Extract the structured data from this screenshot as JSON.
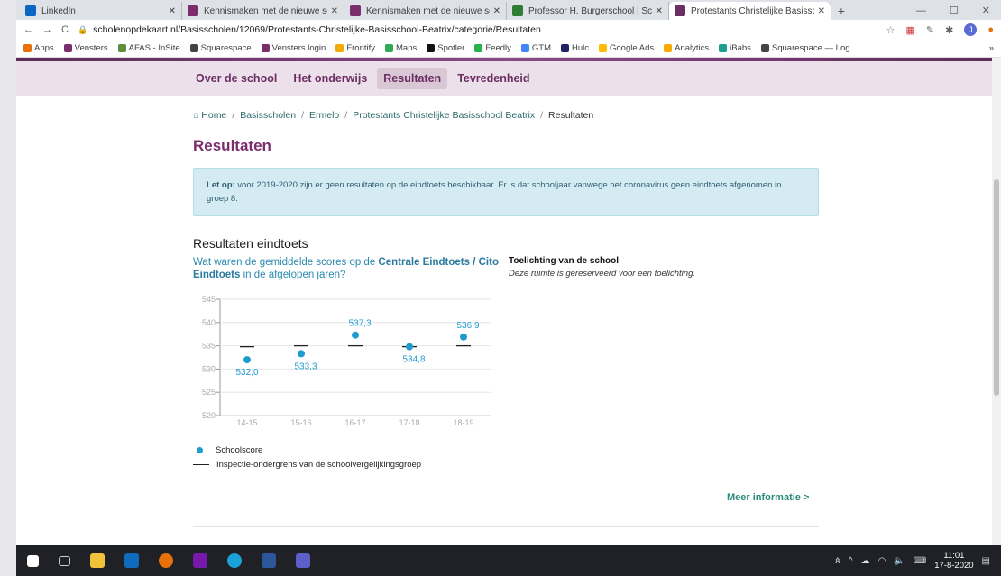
{
  "browser": {
    "tabs": [
      {
        "label": "LinkedIn",
        "color": "#0a66c2"
      },
      {
        "label": "Kennismaken met de nieuwe sch",
        "color": "#7b2d6e"
      },
      {
        "label": "Kennismaken met de nieuwe sch",
        "color": "#7b2d6e"
      },
      {
        "label": "Professor H. Burgerschool | Scho",
        "color": "#2e7d32"
      },
      {
        "label": "Protestants Christelijke Basissch",
        "color": "#6b2e63"
      }
    ],
    "new_tab": "+",
    "url": "scholenopdekaart.nl/Basisscholen/12069/Protestants-Christelijke-Basisschool-Beatrix/categorie/Resultaten",
    "profile_initial": "J",
    "bookmarks": [
      {
        "label": "Apps",
        "color": "#e8710a"
      },
      {
        "label": "Vensters",
        "color": "#7b2d6e"
      },
      {
        "label": "AFAS - InSite",
        "color": "#5f8f3a"
      },
      {
        "label": "Squarespace",
        "color": "#444444"
      },
      {
        "label": "Vensters login",
        "color": "#7b2d6e"
      },
      {
        "label": "Frontify",
        "color": "#f2a900"
      },
      {
        "label": "Maps",
        "color": "#34a853"
      },
      {
        "label": "Spotler",
        "color": "#111111"
      },
      {
        "label": "Feedly",
        "color": "#2bb24c"
      },
      {
        "label": "GTM",
        "color": "#4285f4"
      },
      {
        "label": "Hulc",
        "color": "#222266"
      },
      {
        "label": "Google Ads",
        "color": "#fbbc04"
      },
      {
        "label": "Analytics",
        "color": "#f9ab00"
      },
      {
        "label": "iBabs",
        "color": "#1a9e8f"
      },
      {
        "label": "Squarespace — Log...",
        "color": "#444444"
      }
    ],
    "bookmarks_overflow": "»"
  },
  "nav": {
    "items": [
      "Over de school",
      "Het onderwijs",
      "Resultaten",
      "Tevredenheid"
    ],
    "active": "Resultaten"
  },
  "breadcrumb": {
    "home": "Home",
    "items": [
      "Basisscholen",
      "Ermelo",
      "Protestants Christelijke Basisschool Beatrix"
    ],
    "current": "Resultaten"
  },
  "page": {
    "title": "Resultaten",
    "alert_label": "Let op:",
    "alert_text": " voor 2019-2020 zijn er geen resultaten op de eindtoets beschikbaar. Er is dat schooljaar vanwege het coronavirus geen eindtoets afgenomen in groep 8.",
    "section_title": "Resultaten eindtoets",
    "question_pre": "Wat waren de gemiddelde scores op de ",
    "question_bold": "Centrale Eindtoets / Cito Eindtoets",
    "question_post": " in de afgelopen jaren?",
    "explanation_title": "Toelichting van de school",
    "explanation_text": "Deze ruimte is gereserveerd voor een toelichting.",
    "legend_score": "Schoolscore",
    "legend_line": "Inspectie-ondergrens van de schoolvergelijkingsgroep",
    "more_link": "Meer informatie >"
  },
  "chart_data": {
    "type": "scatter",
    "categories": [
      "14-15",
      "15-16",
      "16-17",
      "17-18",
      "18-19"
    ],
    "series": [
      {
        "name": "Schoolscore",
        "values": [
          532.0,
          533.3,
          537.3,
          534.8,
          536.9
        ],
        "labels": [
          "532,0",
          "533,3",
          "537,3",
          "534,8",
          "536,9"
        ],
        "color": "#1f9bd0"
      },
      {
        "name": "Inspectie-ondergrens van de schoolvergelijkingsgroep",
        "values": [
          534.8,
          535.0,
          535.0,
          534.8,
          535.0
        ],
        "color": "#222222"
      }
    ],
    "yticks": [
      520,
      525,
      530,
      535,
      540,
      545
    ],
    "ylim": [
      520,
      545
    ],
    "grid": true
  },
  "taskbar": {
    "time": "11:01",
    "date": "17-8-2020"
  }
}
